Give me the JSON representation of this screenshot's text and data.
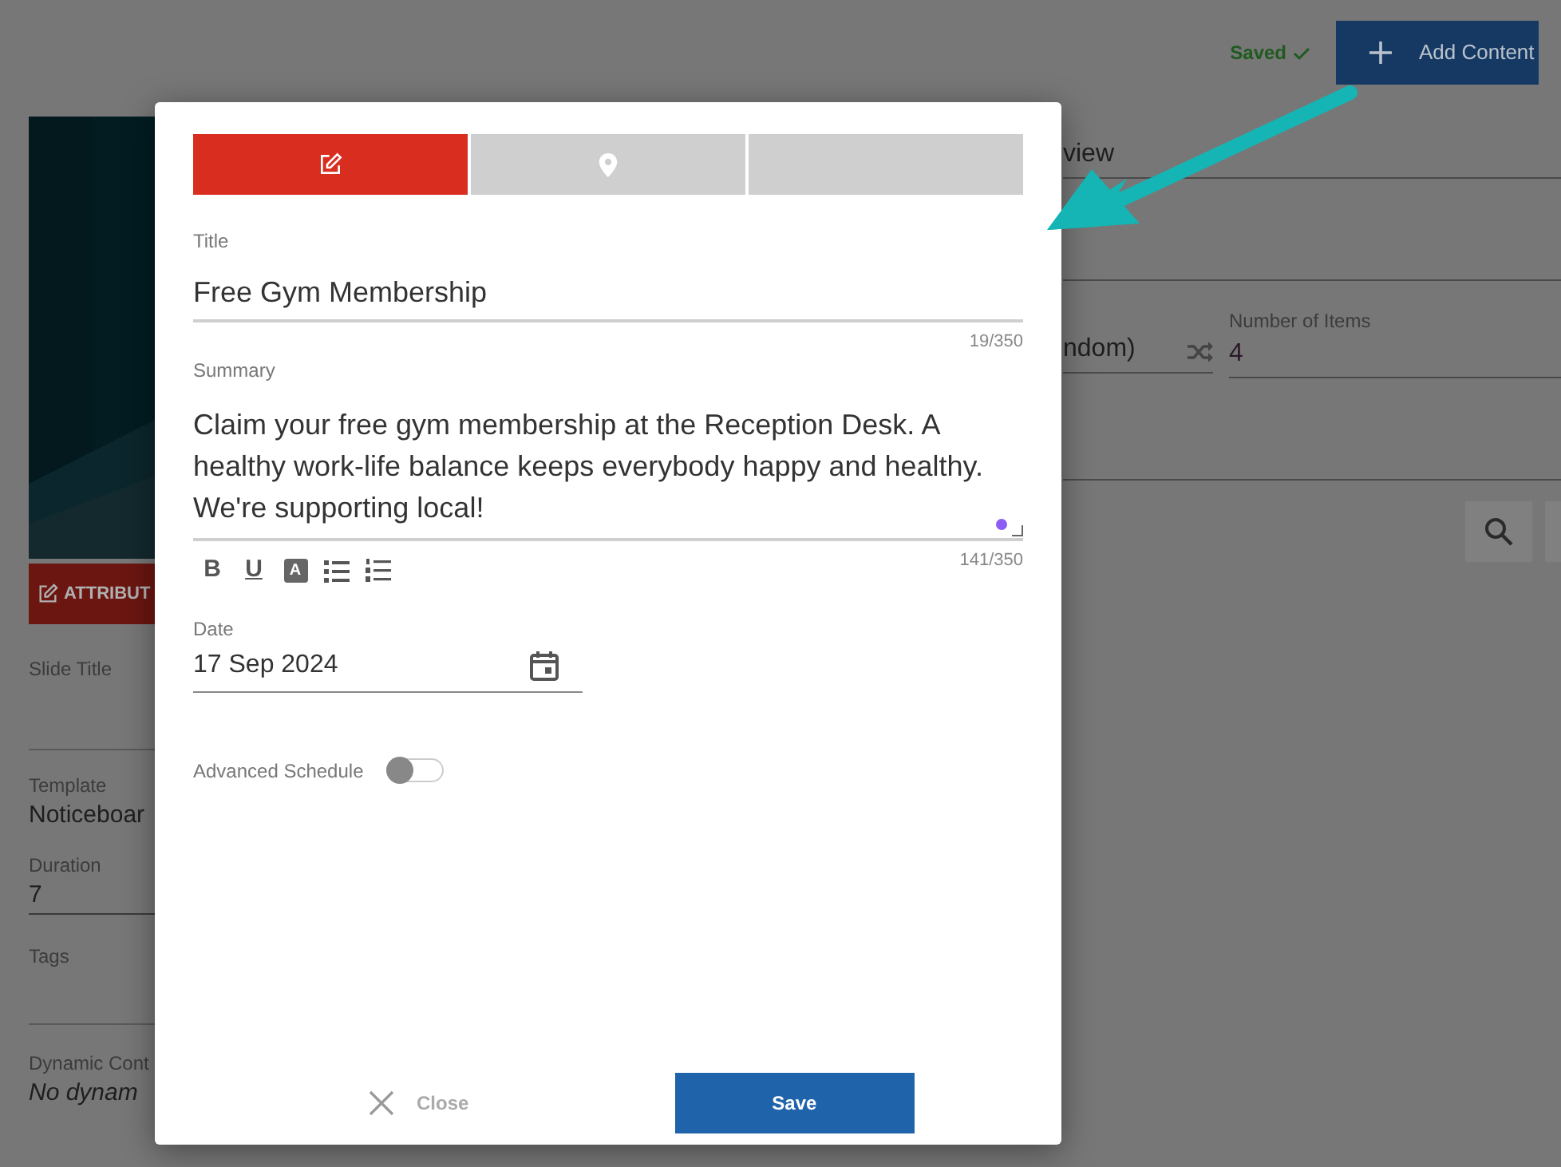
{
  "header": {
    "status": "Saved",
    "add_button": "Add Content"
  },
  "left_panel": {
    "attribute_button": "ATTRIBUT",
    "fields": [
      {
        "label": "Slide Title"
      },
      {
        "label": "Template",
        "value": "Noticeboar"
      },
      {
        "label": "Duration",
        "value": "7"
      },
      {
        "label": "Tags"
      },
      {
        "label": "Dynamic Cont",
        "value": "No dynam",
        "italic": true
      }
    ]
  },
  "right_panel": {
    "field_1": "view",
    "field_2": "ndom)",
    "items_label": "Number of Items",
    "items_value": "4"
  },
  "modal": {
    "tabs": [
      {
        "kind": "edit",
        "selected": true
      },
      {
        "kind": "location",
        "selected": false
      },
      {
        "kind": "blank",
        "selected": false
      }
    ],
    "title": {
      "label": "Title",
      "value": "Free Gym Membership",
      "counter": "19/350"
    },
    "summary": {
      "label": "Summary",
      "value": "Claim your free gym membership at the Reception Desk. A healthy work-life balance keeps everybody happy and healthy. We're supporting local!",
      "counter": "141/350"
    },
    "toolbar": [
      {
        "kind": "bold",
        "label": "B"
      },
      {
        "kind": "underline",
        "label": "U"
      },
      {
        "kind": "highlight",
        "label": "A"
      },
      {
        "kind": "bullets"
      },
      {
        "kind": "numbers"
      }
    ],
    "date": {
      "label": "Date",
      "value": "17 Sep 2024"
    },
    "advanced_schedule": {
      "label": "Advanced Schedule",
      "on": false
    },
    "close": "Close",
    "save": "Save"
  }
}
